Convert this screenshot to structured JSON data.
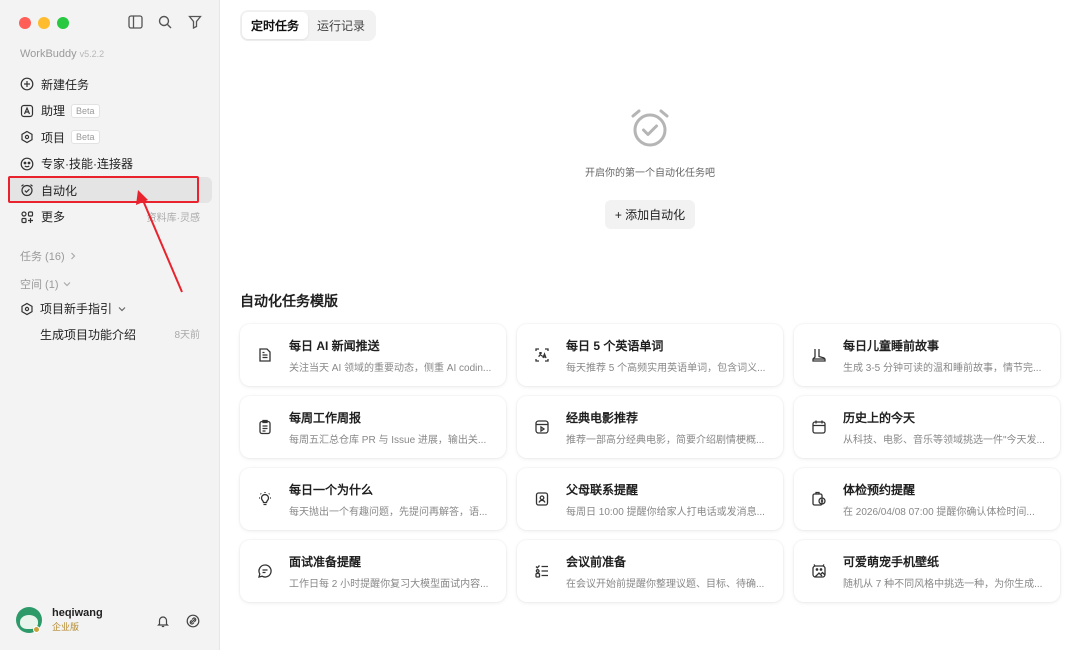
{
  "app": {
    "brand": "WorkBuddy",
    "version": "v5.2.2"
  },
  "sidebar": {
    "nav": [
      {
        "label": "新建任务",
        "icon": "plus-circle-icon"
      },
      {
        "label": "助理",
        "badge": "Beta",
        "icon": "assistant-icon"
      },
      {
        "label": "项目",
        "badge": "Beta",
        "icon": "project-icon"
      },
      {
        "label": "专家·技能·连接器",
        "icon": "expert-icon"
      },
      {
        "label": "自动化",
        "icon": "alarm-clock-icon",
        "active": true
      },
      {
        "label": "更多",
        "icon": "grid-icon",
        "hint": "资料库·灵感"
      }
    ],
    "tasks_label": "任务 (16)",
    "spaces_label": "空间 (1)",
    "project_label": "项目新手指引",
    "project_sub": {
      "label": "生成项目功能介绍",
      "time": "8天前"
    },
    "user": {
      "name": "heqiwang",
      "tier": "企业版"
    }
  },
  "main": {
    "tabs": [
      {
        "label": "定时任务",
        "active": true
      },
      {
        "label": "运行记录"
      }
    ],
    "empty_message": "开启你的第一个自动化任务吧",
    "add_button": "+ 添加自动化",
    "templates_title": "自动化任务模版",
    "templates": [
      {
        "title": "每日 AI 新闻推送",
        "desc": "关注当天 AI 领域的重要动态，侧重 AI codin...",
        "icon": "news-icon"
      },
      {
        "title": "每日 5 个英语单词",
        "desc": "每天推荐 5 个高频实用英语单词，包含词义...",
        "icon": "translate-icon"
      },
      {
        "title": "每日儿童睡前故事",
        "desc": "生成 3-5 分钟可读的温和睡前故事，情节完...",
        "icon": "boot-icon"
      },
      {
        "title": "每周工作周报",
        "desc": "每周五汇总仓库 PR 与 Issue 进展，输出关...",
        "icon": "clipboard-icon"
      },
      {
        "title": "经典电影推荐",
        "desc": "推荐一部高分经典电影，简要介绍剧情梗概...",
        "icon": "film-icon"
      },
      {
        "title": "历史上的今天",
        "desc": "从科技、电影、音乐等领域挑选一件\"今天发...",
        "icon": "calendar-icon"
      },
      {
        "title": "每日一个为什么",
        "desc": "每天抛出一个有趣问题，先提问再解答，语...",
        "icon": "lightbulb-icon"
      },
      {
        "title": "父母联系提醒",
        "desc": "每周日 10:00 提醒你给家人打电话或发消息...",
        "icon": "contact-icon"
      },
      {
        "title": "体检预约提醒",
        "desc": "在 2026/04/08 07:00 提醒你确认体检时间...",
        "icon": "health-icon"
      },
      {
        "title": "面试准备提醒",
        "desc": "工作日每 2 小时提醒你复习大模型面试内容...",
        "icon": "chat-icon"
      },
      {
        "title": "会议前准备",
        "desc": "在会议开始前提醒你整理议题、目标、待确...",
        "icon": "checklist-icon"
      },
      {
        "title": "可爱萌宠手机壁纸",
        "desc": "随机从 7 种不同风格中挑选一种，为你生成...",
        "icon": "pet-image-icon"
      }
    ]
  }
}
